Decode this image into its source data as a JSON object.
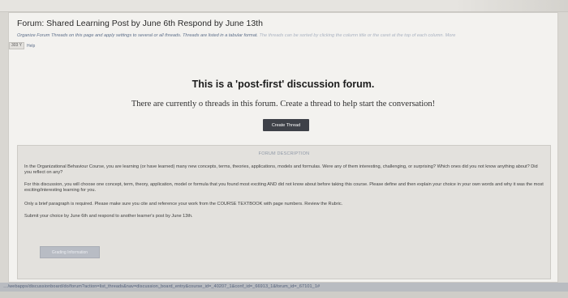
{
  "forum": {
    "title": "Forum: Shared Learning Post by June 6th Respond by June 13th",
    "instructions_main": "Organize Forum Threads on this page and apply settings to several or all threads. Threads are listed in a tabular format.",
    "instructions_faded": " The threads can be sorted by clicking the column title or the caret at the top of each column. More",
    "help_badge": "303 Y",
    "help_link": "Help"
  },
  "main": {
    "heading": "This is a 'post-first' discussion forum.",
    "message": "There are currently o threads in this forum. Create a thread to help start the conversation!",
    "create_button": "Create Thread"
  },
  "description": {
    "label": "FORUM DESCRIPTION",
    "paragraphs": [
      "In the Organizational Behaviour Course, you are learning (or have learned) many new concepts, terms, theories, applications, models and formulas.  Were any of them interesting, challenging, or surprising? Which ones did you not know anything about? Did you reflect on any?",
      "For this discussion, you will choose one concept, term, theory, application, model or formula that you found most exciting AND did not know about before taking this course. Please define and then explain your choice in your own words and why it was the most exciting/interesting learning for you.",
      "Only a brief paragraph is required.  Please make sure you cite and reference your work from the COURSE TEXTBOOK with page numbers.  Review the Rubric.",
      "Submit your choice by June 6th and respond to another learner's post by June 13th."
    ],
    "grading_button": "Grading Information"
  },
  "status_bar": {
    "url": "…/webapps/discussionboard/do/forum?action=list_threads&nav=discussion_board_entry&course_id=_40207_1&conf_id=_66913_1&forum_id=_67101_1#"
  }
}
